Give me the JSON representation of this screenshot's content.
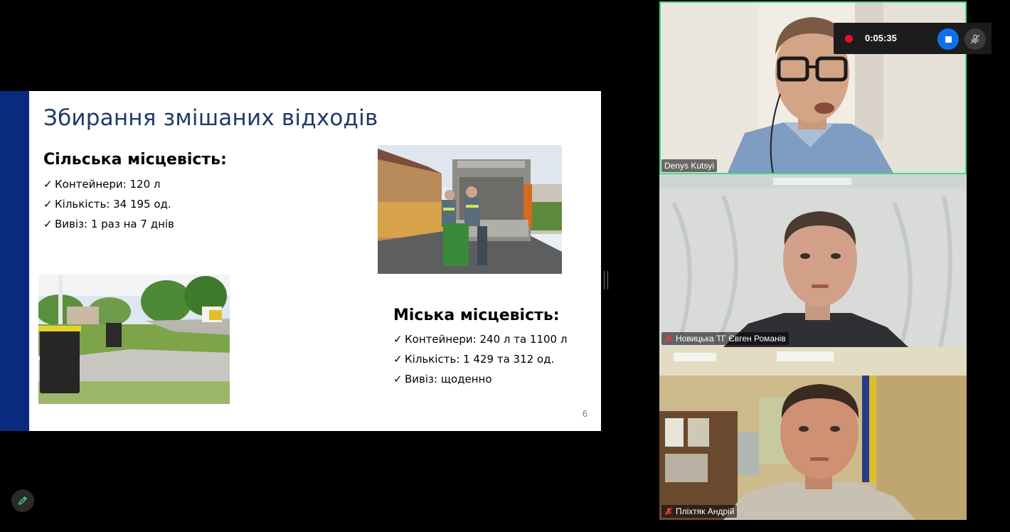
{
  "slide": {
    "title": "Збирання змішаних відходів",
    "rural": {
      "heading": "Сільська місцевість:",
      "items": [
        "Контейнери: 120 л",
        "Кількість: 34 195 од.",
        "Вивіз: 1 раз на 7 днів"
      ]
    },
    "urban": {
      "heading": "Міська місцевість:",
      "items": [
        "Контейнери: 240 л та 1100 л",
        "Кількість: 1 429 та 312 од.",
        "Вивіз: щоденно"
      ]
    },
    "check_mark": "✓",
    "page_number": "6"
  },
  "participants": [
    {
      "name": "Denys Kutsyi",
      "muted": false,
      "active_speaker": true
    },
    {
      "name": "Новицька ТГ Євген Романів",
      "muted": true,
      "active_speaker": false
    },
    {
      "name": "Пліхтяк Андрій",
      "muted": true,
      "active_speaker": false
    }
  ],
  "recording": {
    "time": "0:05:35"
  },
  "icons": {
    "record": "record-dot-icon",
    "stop": "stop-icon",
    "mute": "microphone-off-icon",
    "annotate": "pencil-icon"
  },
  "colors": {
    "accent_active": "#3ddc84",
    "record_red": "#e81123",
    "stop_blue": "#0e71eb",
    "slide_bar": "#0a2a7f"
  }
}
